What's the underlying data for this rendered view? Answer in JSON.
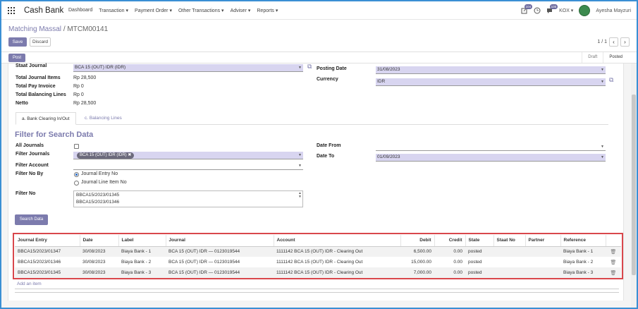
{
  "app": {
    "title": "Cash Bank"
  },
  "menu": [
    "Dashboard",
    "Transaction ▾",
    "Payment Order ▾",
    "Other Transactions ▾",
    "Adviser ▾",
    "Reports ▾"
  ],
  "systray": {
    "activity_count": "104",
    "message_count": "105",
    "company": "KOX ▾",
    "user": "Ayesha Mayzuri"
  },
  "breadcrumb": {
    "parent": "Matching Massal",
    "separator": "/",
    "current": "MTCM00141"
  },
  "buttons": {
    "save": "Save",
    "discard": "Discard",
    "post": "Post",
    "search_data": "Search Data",
    "add_item": "Add an item"
  },
  "pager": {
    "text": "1 / 1",
    "prev": "‹",
    "next": "›"
  },
  "states": [
    "Draft",
    "Posted"
  ],
  "form": {
    "staat_journal": {
      "label": "Staat Journal",
      "value": "BCA 15 (OUT) IDR (IDR)"
    },
    "total_journal_items": {
      "label": "Total Journal Items",
      "value": "Rp 28,500"
    },
    "total_pay_invoice": {
      "label": "Total Pay Invoice",
      "value": "Rp 0"
    },
    "total_balancing_lines": {
      "label": "Total Balancing Lines",
      "value": "Rp 0"
    },
    "netto": {
      "label": "Netto",
      "value": "Rp 28,500"
    },
    "posting_date": {
      "label": "Posting Date",
      "value": "31/08/2023"
    },
    "currency": {
      "label": "Currency",
      "value": "IDR"
    }
  },
  "tabs": [
    "a. Bank Clearing In/Out",
    "c. Balancing Lines"
  ],
  "filter": {
    "title": "Filter for Search Data",
    "all_journals_label": "All Journals",
    "filter_journals_label": "Filter Journals",
    "filter_journals_tag": "BCA 15 (OUT) IDR (IDR)",
    "filter_account_label": "Filter Account",
    "filter_account_value": "",
    "filter_no_by_label": "Filter No By",
    "radio_options": [
      "Journal Entry No",
      "Journal Line Item No"
    ],
    "filter_no_label": "Filter No",
    "filter_no_lines": [
      "BBCA15/2023/01345",
      "BBCA15/2023/01346"
    ],
    "date_from_label": "Date From",
    "date_from_value": "",
    "date_to_label": "Date To",
    "date_to_value": "01/09/2023"
  },
  "table": {
    "headers": [
      "Journal Entry",
      "Date",
      "Label",
      "Journal",
      "Account",
      "Debit",
      "Credit",
      "State",
      "Staat No",
      "Partner",
      "Reference"
    ],
    "rows": [
      [
        "BBCA15/2023/01347",
        "30/08/2023",
        "Biaya Bank - 1",
        "BCA 15 (OUT) IDR — 0123019544",
        "1111142 BCA 15 (OUT) IDR - Clearing Out",
        "6,500.00",
        "0.00",
        "posted",
        "",
        "",
        "Biaya Bank - 1"
      ],
      [
        "BBCA15/2023/01346",
        "30/08/2023",
        "Biaya Bank - 2",
        "BCA 15 (OUT) IDR — 0123019544",
        "1111142 BCA 15 (OUT) IDR - Clearing Out",
        "15,000.00",
        "0.00",
        "posted",
        "",
        "",
        "Biaya Bank - 2"
      ],
      [
        "BBCA15/2023/01345",
        "30/08/2023",
        "Biaya Bank - 3",
        "BCA 15 (OUT) IDR — 0123019544",
        "1111142 BCA 15 (OUT) IDR - Clearing Out",
        "7,000.00",
        "0.00",
        "posted",
        "",
        "",
        "Biaya Bank - 3"
      ]
    ]
  },
  "colors": {
    "accent": "#7c7bad",
    "required_bg": "#d8d5f0",
    "highlight_border": "#d9474c",
    "frame_border": "#3a8fd4"
  }
}
